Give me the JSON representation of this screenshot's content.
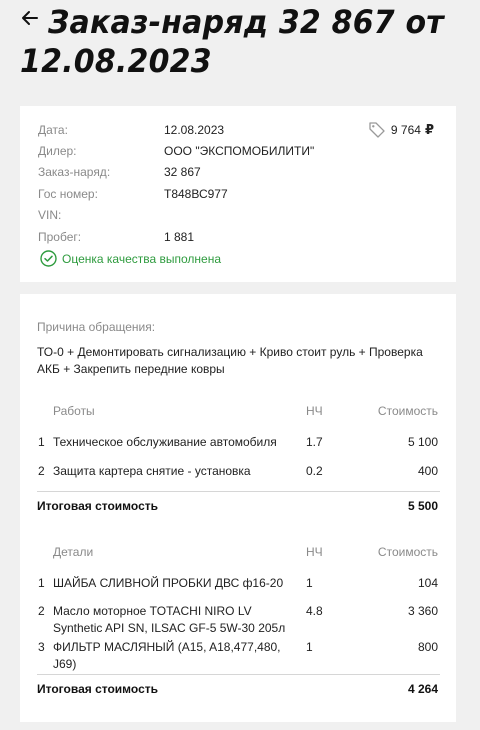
{
  "header": {
    "title": "Заказ-наряд 32 867 от 12.08.2023",
    "back_icon": "arrow-left-icon"
  },
  "summary": {
    "rows": [
      {
        "label": "Дата:",
        "value": "12.08.2023"
      },
      {
        "label": "Дилер:",
        "value": "ООО \"ЭКСПОМОБИЛИТИ\""
      },
      {
        "label": "Заказ-наряд:",
        "value": "32 867"
      },
      {
        "label": "Гос номер:",
        "value": "Т848ВС977"
      },
      {
        "label": "VIN:",
        "value": ""
      },
      {
        "label": "Пробег:",
        "value": "1 881"
      }
    ],
    "price": "9 764",
    "currency": "₽",
    "price_icon": "tag-icon",
    "quality_text": "Оценка качества выполнена",
    "quality_icon": "check-circle-icon",
    "quality_color": "#2e9b3e"
  },
  "details": {
    "reason_label": "Причина обращения:",
    "reason_text": "ТО-0 + Демонтировать сигнализацию + Криво стоит руль + Проверка АКБ + Закрепить передние ковры",
    "works": {
      "headers": {
        "name": "Работы",
        "nh": "НЧ",
        "cost": "Стоимость"
      },
      "rows": [
        {
          "num": "1",
          "name": "Техническое обслуживание автомобиля",
          "nh": "1.7",
          "cost": "5 100"
        },
        {
          "num": "2",
          "name": "Защита картера снятие - установка",
          "nh": "0.2",
          "cost": "400"
        }
      ],
      "total_label": "Итоговая стоимость",
      "total_value": "5 500"
    },
    "parts": {
      "headers": {
        "name": "Детали",
        "nh": "НЧ",
        "cost": "Стоимость"
      },
      "rows": [
        {
          "num": "1",
          "name": "ШАЙБА СЛИВНОЙ ПРОБКИ ДВС ф16-20",
          "nh": "1",
          "cost": "104"
        },
        {
          "num": "2",
          "name": "Масло моторное TOTACHI NIRO LV Synthetic API SN, ILSAC GF-5 5W-30 205л",
          "nh": "4.8",
          "cost": "3 360"
        },
        {
          "num": "3",
          "name": "ФИЛЬТР МАСЛЯНЫЙ (A15, A18,477,480, J69)",
          "nh": "1",
          "cost": "800"
        }
      ],
      "total_label": "Итоговая стоимость",
      "total_value": "4 264"
    }
  }
}
